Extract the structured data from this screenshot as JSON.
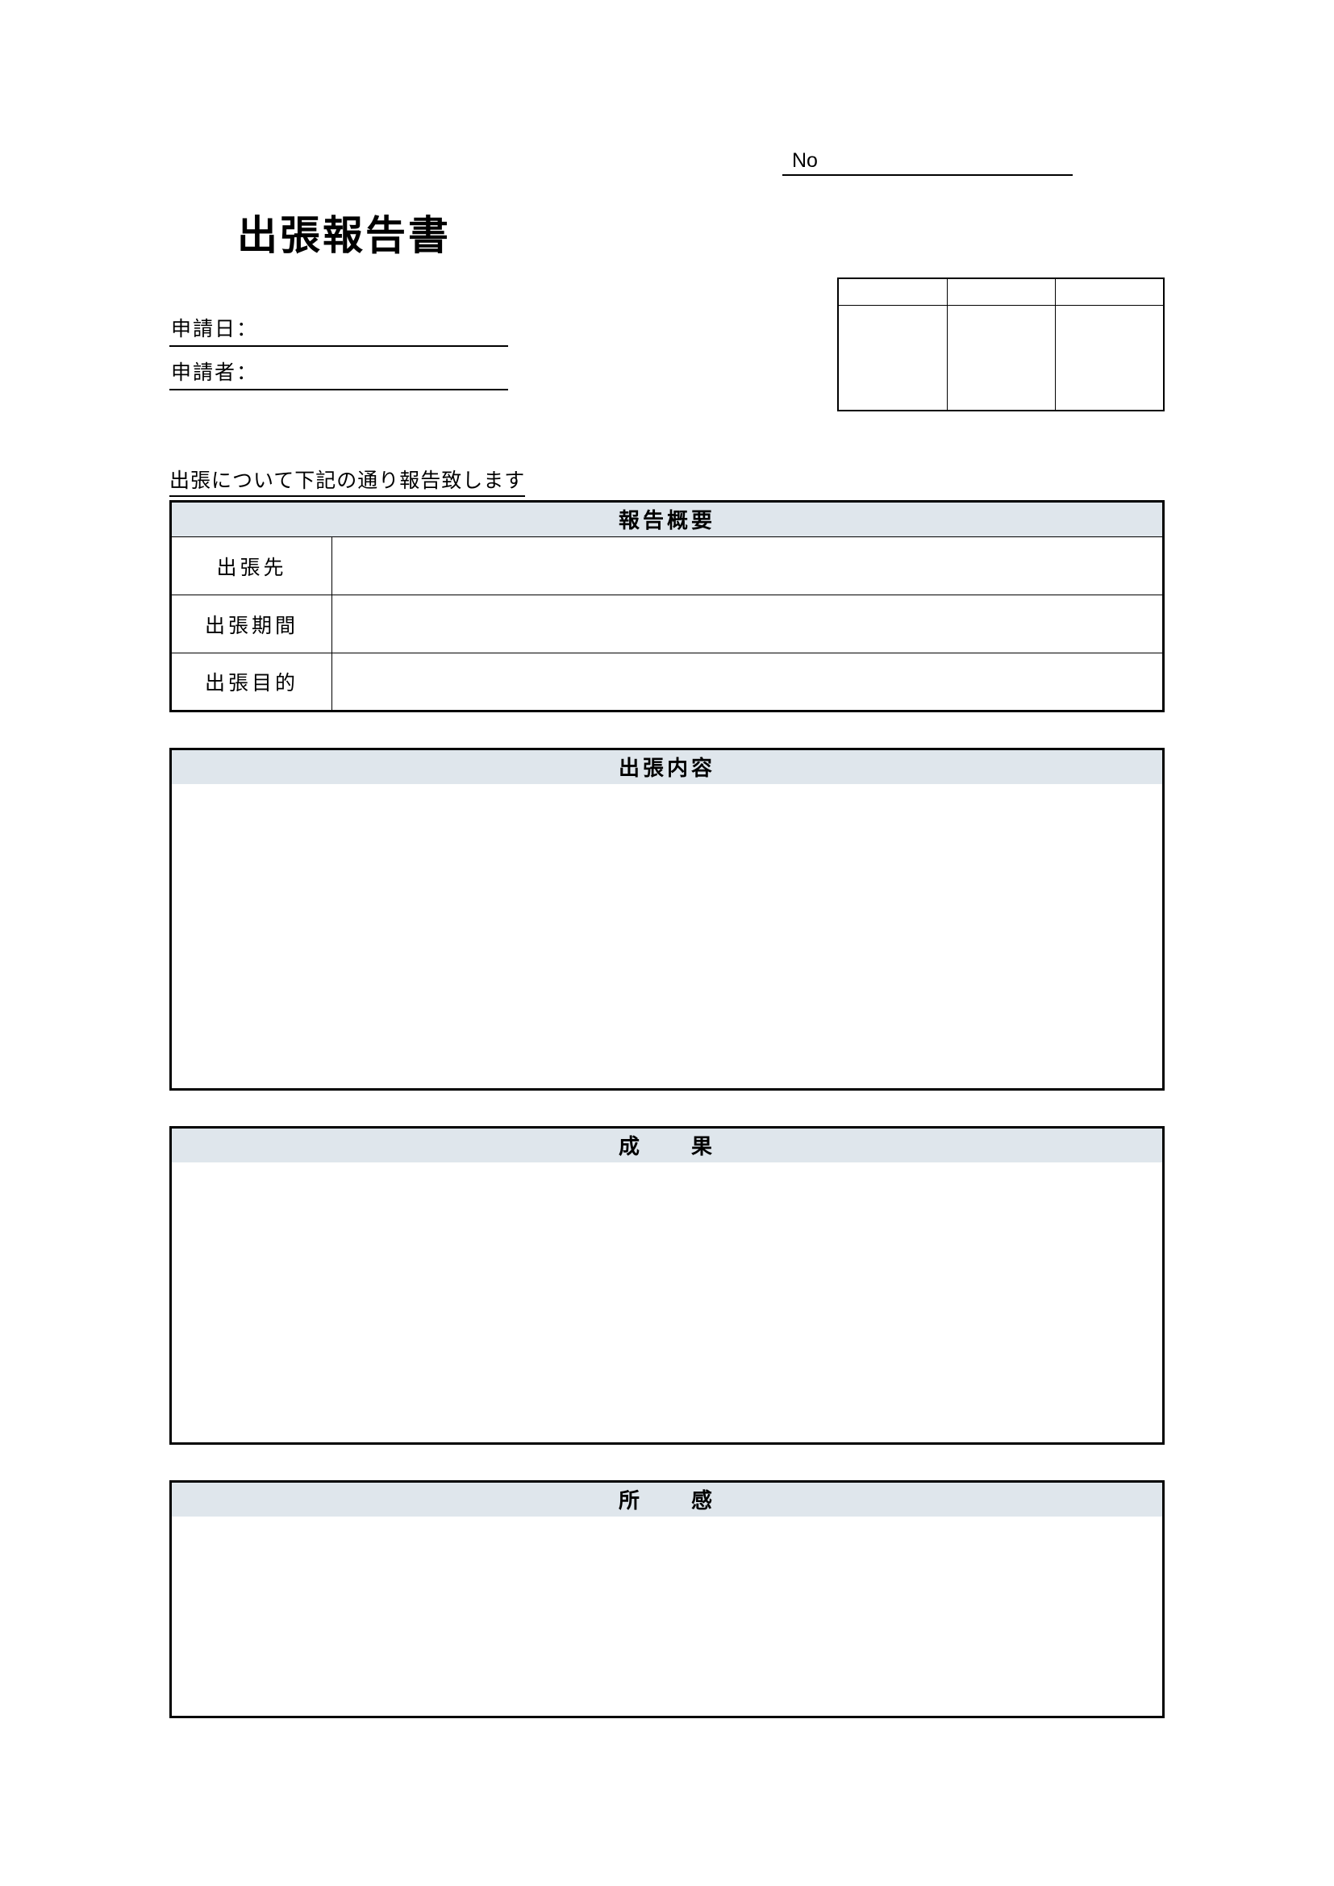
{
  "header": {
    "no_label": "No",
    "title": "出張報告書",
    "date_label": "申請日：",
    "applicant_label": "申請者：",
    "intro": "出張について下記の通り報告致します"
  },
  "summary": {
    "title": "報告概要",
    "rows": {
      "destination": "出張先",
      "period": "出張期間",
      "purpose": "出張目的"
    }
  },
  "sections": {
    "content": "出張内容",
    "results": "成　　果",
    "thoughts": "所　　感"
  }
}
